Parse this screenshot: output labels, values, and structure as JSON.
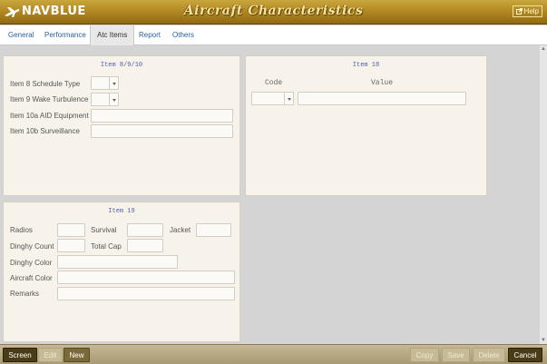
{
  "header": {
    "logo_text": "NAVBLUE",
    "title": "Aircraft Characteristics",
    "help_label": "Help",
    "help_icon": "external-link-icon"
  },
  "tabs": [
    {
      "label": "General",
      "active": false
    },
    {
      "label": "Performance",
      "active": false
    },
    {
      "label": "Atc Items",
      "active": true
    },
    {
      "label": "Report",
      "active": false
    },
    {
      "label": "Others",
      "active": false
    }
  ],
  "item8910": {
    "title": "Item 8/9/10",
    "schedule_type_label": "Item 8 Schedule Type",
    "schedule_type_value": "",
    "wake_turbulence_label": "Item 9 Wake Turbulence",
    "wake_turbulence_value": "",
    "aid_equipment_label": "Item 10a AID Equipment",
    "aid_equipment_value": "",
    "surveillance_label": "Item 10b Surveillance",
    "surveillance_value": ""
  },
  "item18": {
    "title": "Item 18",
    "code_header": "Code",
    "value_header": "Value",
    "code_value": "",
    "value_value": ""
  },
  "item19": {
    "title": "Item 19",
    "radios_label": "Radios",
    "survival_label": "Survival",
    "jacket_label": "Jacket",
    "dinghy_count_label": "Dinghy Count",
    "total_cap_label": "Total Cap",
    "dinghy_color_label": "Dinghy Color",
    "aircraft_color_label": "Aircraft Color",
    "remarks_label": "Remarks"
  },
  "footer": {
    "screen_label": "Screen",
    "edit_label": "Edit",
    "new_label": "New",
    "copy_label": "Copy",
    "save_label": "Save",
    "delete_label": "Delete",
    "cancel_label": "Cancel"
  },
  "colors": {
    "header_gold": "#b48a24",
    "title_text": "#f6e4a0",
    "tab_link": "#2a5d9a",
    "panel_bg": "#f7f3ea",
    "panel_title": "#4a5fb0",
    "footer_dark": "#4a3c16"
  }
}
